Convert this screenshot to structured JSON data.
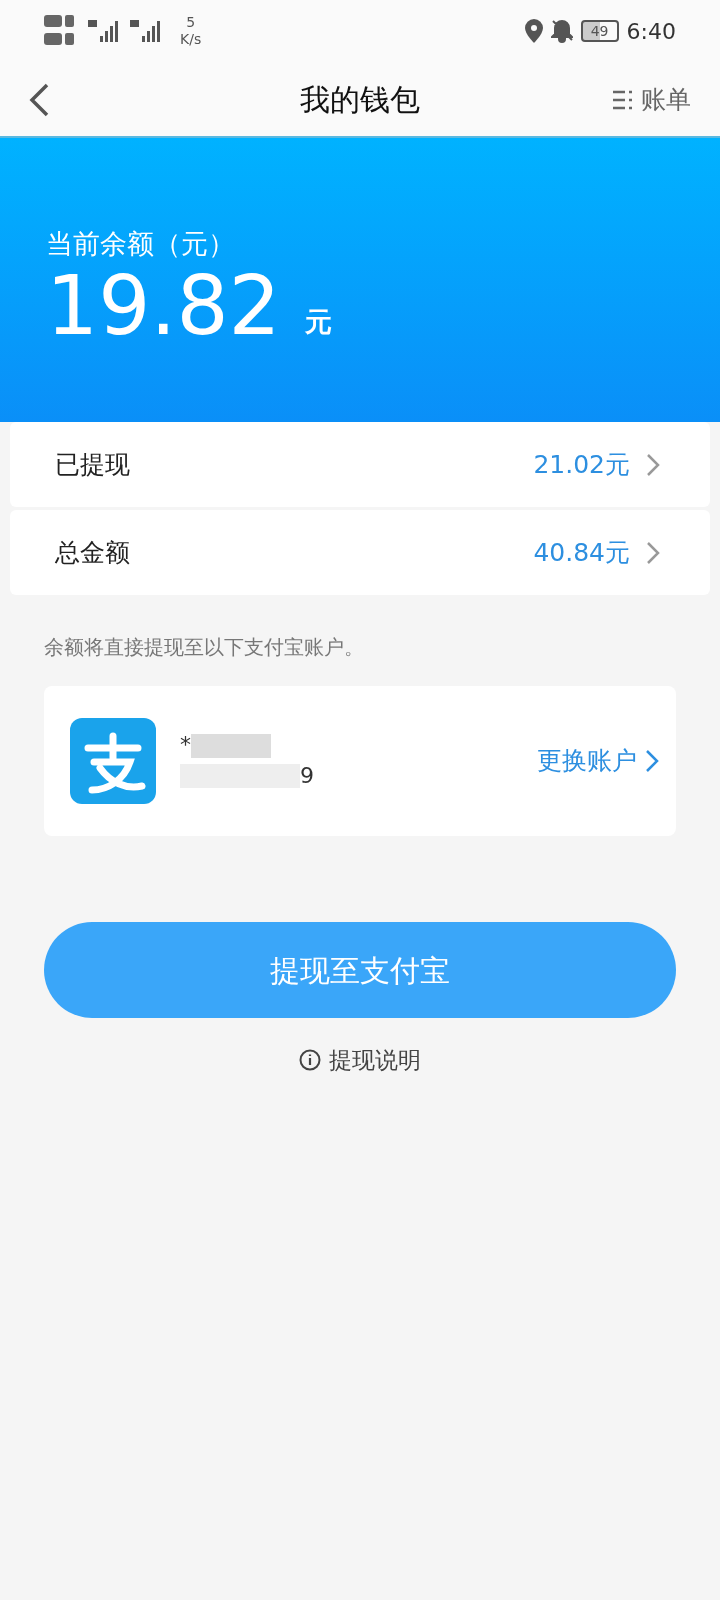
{
  "status_bar": {
    "network_speed_value": "5",
    "network_speed_unit": "K/s",
    "battery": "49",
    "time": "6:40"
  },
  "header": {
    "title": "我的钱包",
    "action": "账单"
  },
  "balance": {
    "label": "当前余额（元）",
    "amount": "19.82",
    "unit": "元"
  },
  "stats": [
    {
      "label": "已提现",
      "value": "21.02元"
    },
    {
      "label": "总金额",
      "value": "40.84元"
    }
  ],
  "note": "余额将直接提现至以下支付宝账户。",
  "account": {
    "name": "*",
    "number": "9",
    "change": "更换账户"
  },
  "withdraw_button": "提现至支付宝",
  "help": "提现说明"
}
